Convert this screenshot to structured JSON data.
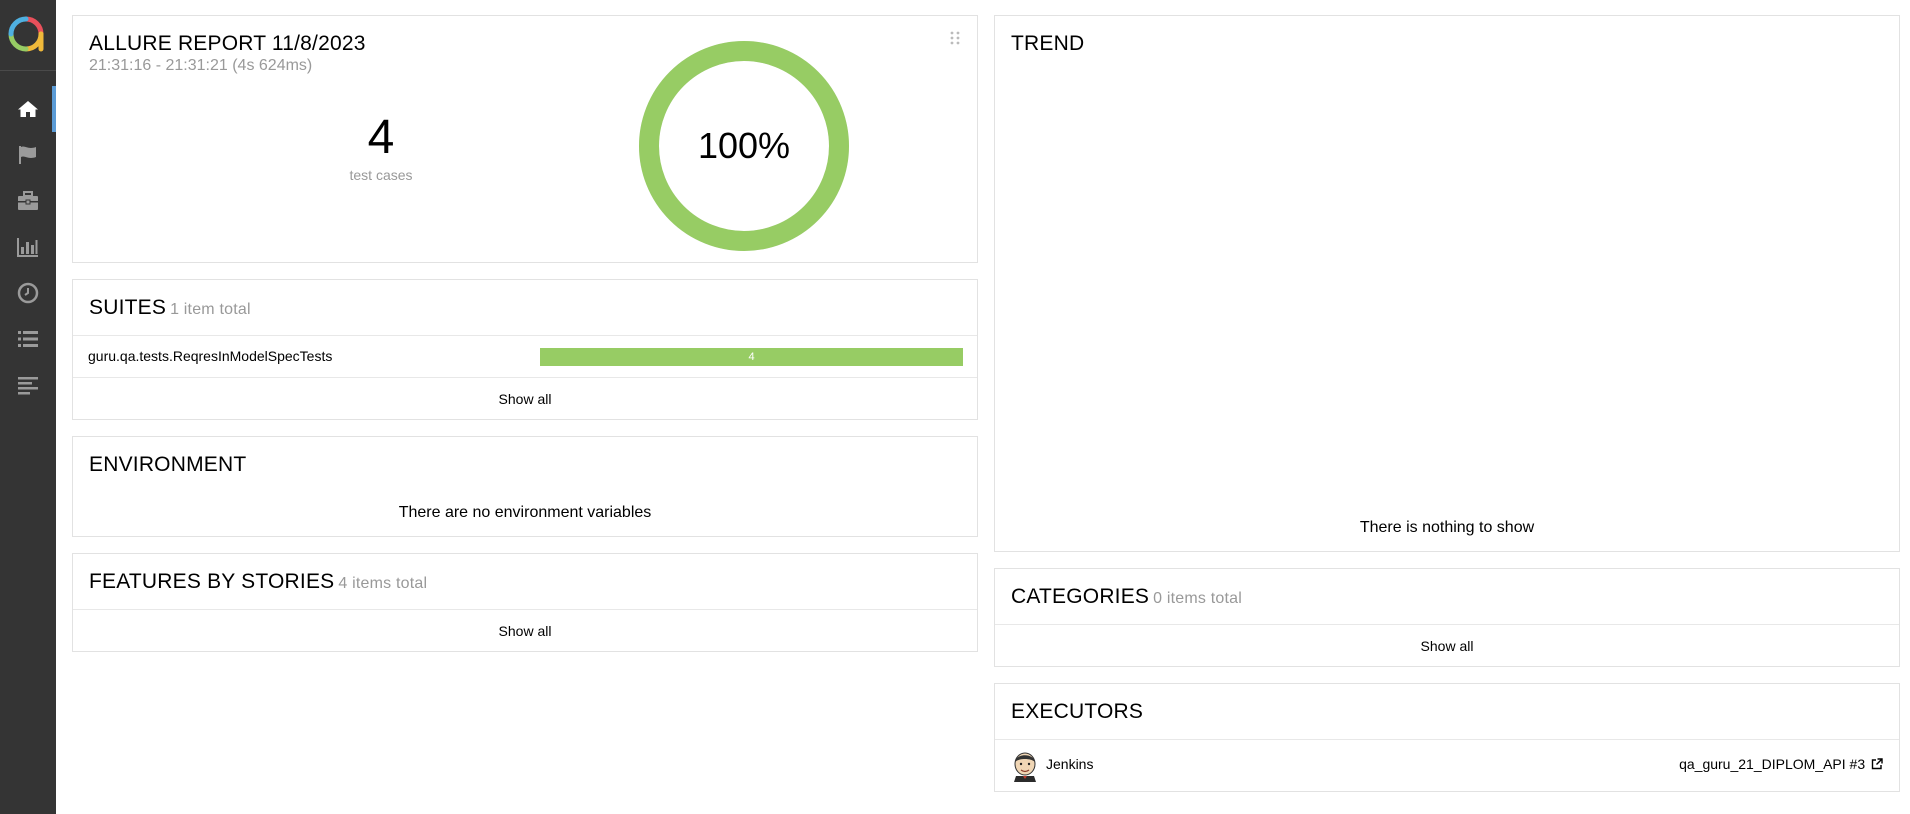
{
  "colors": {
    "sidebar_bg": "#343434",
    "active_indicator": "#5b9bd5",
    "passed": "#97cc64",
    "muted_text": "#999999"
  },
  "sidebar": {
    "items": [
      {
        "icon": "home-icon",
        "label": "Overview",
        "active": true
      },
      {
        "icon": "flag-icon",
        "label": "Categories",
        "active": false
      },
      {
        "icon": "briefcase-icon",
        "label": "Suites",
        "active": false
      },
      {
        "icon": "bar-chart-icon",
        "label": "Graphs",
        "active": false
      },
      {
        "icon": "clock-icon",
        "label": "Timeline",
        "active": false
      },
      {
        "icon": "list-icon",
        "label": "Behaviors",
        "active": false
      },
      {
        "icon": "align-left-icon",
        "label": "Packages",
        "active": false
      }
    ]
  },
  "summary": {
    "title": "ALLURE REPORT 11/8/2023",
    "time_range": "21:31:16 - 21:31:21 (4s 624ms)",
    "test_count": "4",
    "test_count_label": "test cases",
    "percent_label": "100%",
    "passed_fraction": 1.0
  },
  "suites": {
    "title": "SUITES",
    "count_label": "1 item total",
    "rows": [
      {
        "name": "guru.qa.tests.ReqresInModelSpecTests",
        "passed": "4",
        "passed_fraction": 1.0
      }
    ],
    "show_all": "Show all"
  },
  "environment": {
    "title": "ENVIRONMENT",
    "empty_message": "There are no environment variables"
  },
  "features": {
    "title": "FEATURES BY STORIES",
    "count_label": "4 items total",
    "show_all": "Show all"
  },
  "trend": {
    "title": "TREND",
    "empty_message": "There is nothing to show"
  },
  "categories": {
    "title": "CATEGORIES",
    "count_label": "0 items total",
    "show_all": "Show all"
  },
  "executors": {
    "title": "EXECUTORS",
    "name": "Jenkins",
    "build_link": "qa_guru_21_DIPLOM_API #3"
  }
}
